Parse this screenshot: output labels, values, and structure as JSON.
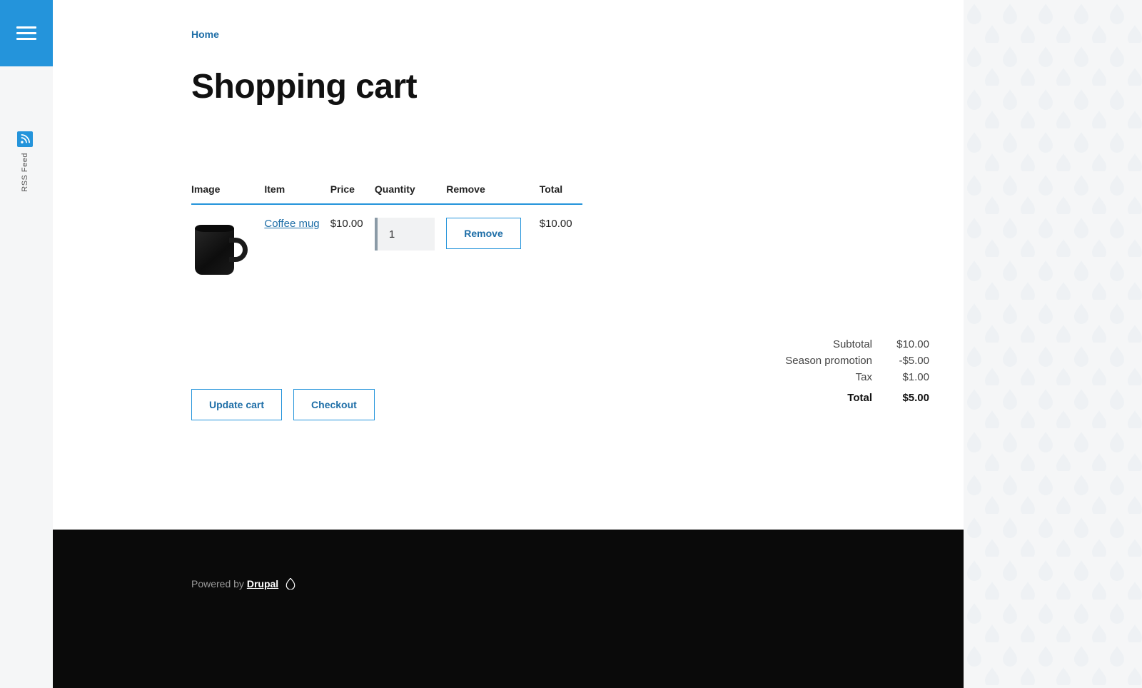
{
  "nav": {
    "rss_label": "RSS Feed"
  },
  "breadcrumb": {
    "home": "Home"
  },
  "page": {
    "title": "Shopping cart"
  },
  "cart": {
    "headers": {
      "image": "Image",
      "item": "Item",
      "price": "Price",
      "quantity": "Quantity",
      "remove": "Remove",
      "total": "Total"
    },
    "items": [
      {
        "name": "Coffee mug",
        "price": "$10.00",
        "quantity": "1",
        "remove_label": "Remove",
        "line_total": "$10.00"
      }
    ]
  },
  "summary": {
    "rows": [
      {
        "label": "Subtotal",
        "value": "$10.00"
      },
      {
        "label": "Season promotion",
        "value": "-$5.00"
      },
      {
        "label": "Tax",
        "value": "$1.00"
      }
    ],
    "total_label": "Total",
    "total_value": "$5.00"
  },
  "actions": {
    "update": "Update cart",
    "checkout": "Checkout"
  },
  "footer": {
    "powered_by": "Powered by ",
    "drupal": "Drupal"
  }
}
